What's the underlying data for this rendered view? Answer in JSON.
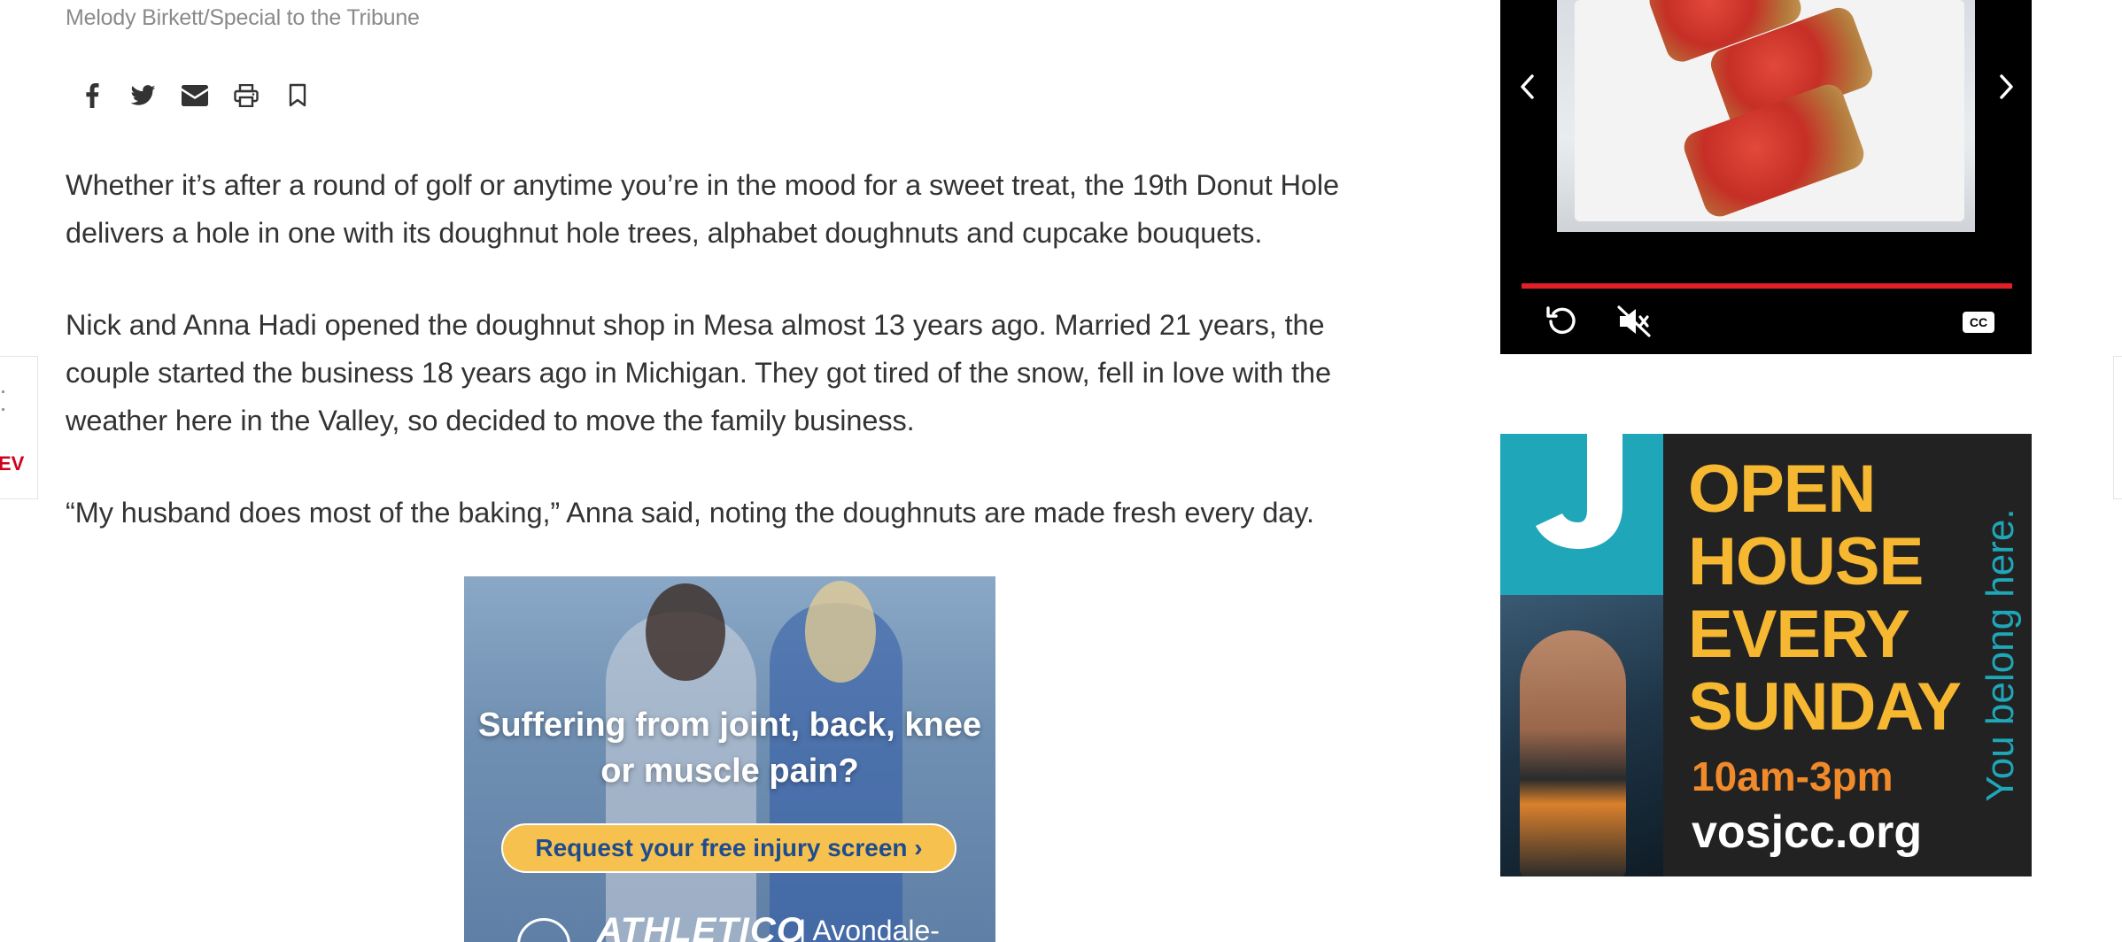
{
  "photo_caption": "Melody Birkett/Special to the Tribune",
  "share_icons": [
    "facebook-icon",
    "twitter-icon",
    "email-icon",
    "print-icon",
    "bookmark-icon"
  ],
  "article": {
    "paragraphs": [
      "Whether it’s after a round of golf or anytime you’re in the mood for a sweet treat, the 19th Donut Hole delivers a hole in one with its doughnut hole trees, alphabet doughnuts and cupcake bouquets.",
      "Nick and Anna Hadi opened the doughnut shop in Mesa almost 13 years ago. Married 21 years, the couple started the business 18 years ago in Michigan. They got tired of the snow, fell in love with the weather here in the Valley, so decided to move the family business.",
      "“My husband does most of the baking,” Anna said, noting the doughnuts are made fresh every day."
    ]
  },
  "inline_ad": {
    "headline": "Suffering from joint, back, knee or muscle pain?",
    "cta": "Request your free injury screen ›",
    "brand": "ATHLETICO",
    "location": "| Avondale-"
  },
  "video_player": {
    "prev_icon": "chevron-left-icon",
    "next_icon": "chevron-right-icon",
    "replay_icon": "replay-icon",
    "mute_icon": "muted-speaker-icon",
    "cc_label": "CC",
    "progress_color": "#e01f26"
  },
  "side_ad": {
    "headline_lines": [
      "OPEN",
      "HOUSE",
      "EVERY",
      "SUNDAY"
    ],
    "hours": "10am-3pm",
    "url": "vosjcc.org",
    "tagline": "You belong here.",
    "accent_color": "#f6b731",
    "teal_color": "#1fa6b8"
  },
  "left_edge": {
    "label": "EV"
  },
  "colors": {
    "text": "#333333",
    "caption": "#8a8a8a",
    "brand_red": "#d0021b"
  }
}
